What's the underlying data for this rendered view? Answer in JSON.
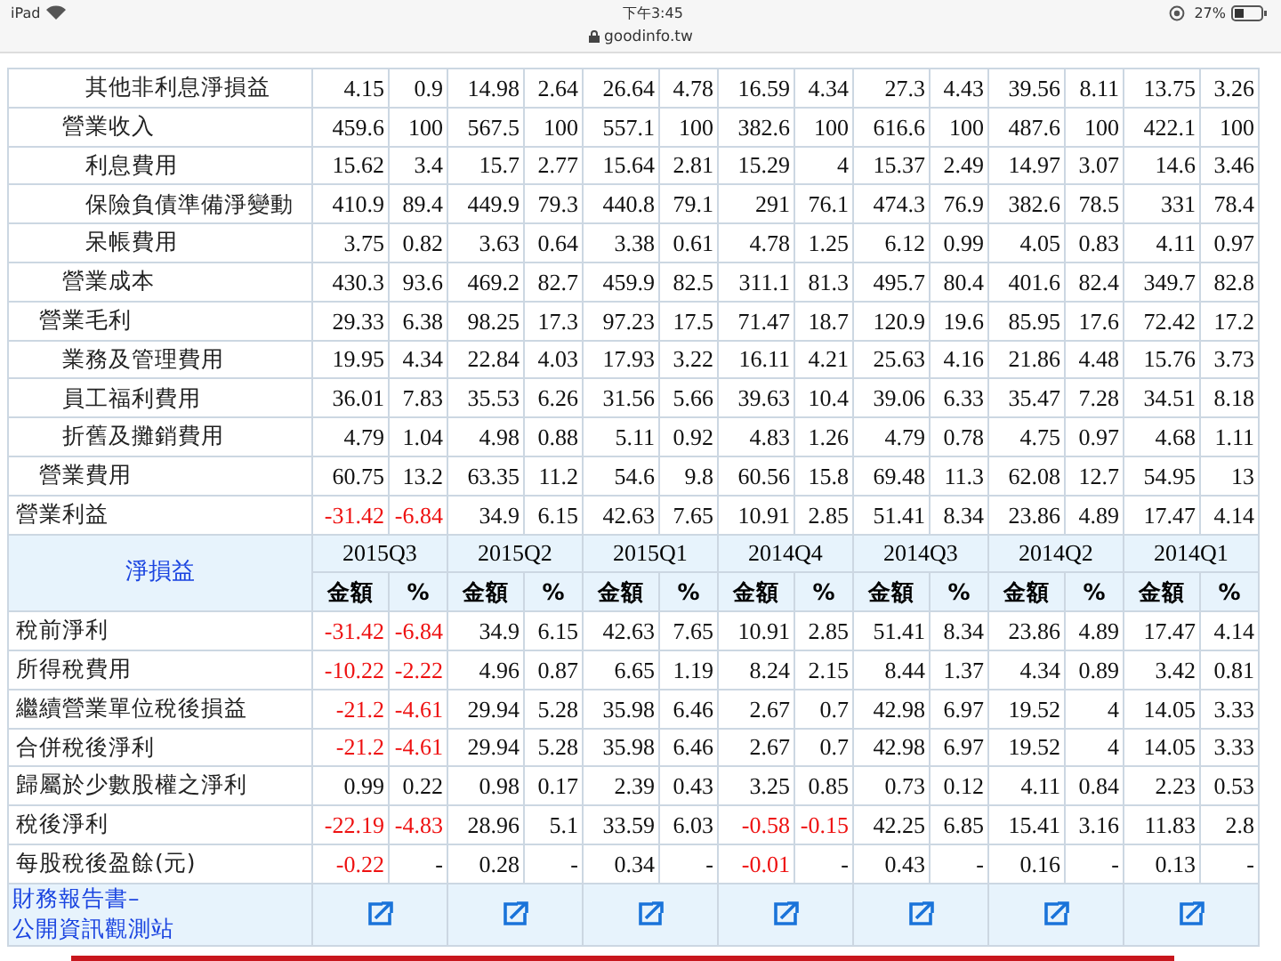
{
  "status_bar": {
    "device": "iPad",
    "time": "下午3:45",
    "battery": "27%"
  },
  "address_bar": {
    "url": "goodinfo.tw"
  },
  "upper_table": {
    "rows": [
      {
        "label": "營業利益",
        "values": [
          "-31.42",
          "-6.84",
          "34.9",
          "6.15",
          "42.63",
          "7.65",
          "10.91",
          "2.85",
          "51.41",
          "8.34",
          "23.86",
          "4.89",
          "17.47",
          "4.14"
        ],
        "red_cells": [
          true,
          true,
          false,
          false,
          false,
          false,
          false,
          false,
          false,
          false,
          false,
          false,
          false,
          false
        ],
        "children": [
          {
            "label": "營業毛利",
            "values": [
              "29.33",
              "6.38",
              "98.25",
              "17.3",
              "97.23",
              "17.5",
              "71.47",
              "18.7",
              "120.9",
              "19.6",
              "85.95",
              "17.6",
              "72.42",
              "17.2"
            ],
            "children": [
              {
                "label": "營業收入",
                "values": [
                  "459.6",
                  "100",
                  "567.5",
                  "100",
                  "557.1",
                  "100",
                  "382.6",
                  "100",
                  "616.6",
                  "100",
                  "487.6",
                  "100",
                  "422.1",
                  "100"
                ],
                "children": [
                  {
                    "label": "其他非利息淨損益",
                    "values": [
                      "4.15",
                      "0.9",
                      "14.98",
                      "2.64",
                      "26.64",
                      "4.78",
                      "16.59",
                      "4.34",
                      "27.3",
                      "4.43",
                      "39.56",
                      "8.11",
                      "13.75",
                      "3.26"
                    ]
                  }
                ]
              },
              {
                "label": "營業成本",
                "values": [
                  "430.3",
                  "93.6",
                  "469.2",
                  "82.7",
                  "459.9",
                  "82.5",
                  "311.1",
                  "81.3",
                  "495.7",
                  "80.4",
                  "401.6",
                  "82.4",
                  "349.7",
                  "82.8"
                ],
                "children": [
                  {
                    "label": "利息費用",
                    "values": [
                      "15.62",
                      "3.4",
                      "15.7",
                      "2.77",
                      "15.64",
                      "2.81",
                      "15.29",
                      "4",
                      "15.37",
                      "2.49",
                      "14.97",
                      "3.07",
                      "14.6",
                      "3.46"
                    ]
                  },
                  {
                    "label": "保險負債準備淨變動",
                    "values": [
                      "410.9",
                      "89.4",
                      "449.9",
                      "79.3",
                      "440.8",
                      "79.1",
                      "291",
                      "76.1",
                      "474.3",
                      "76.9",
                      "382.6",
                      "78.5",
                      "331",
                      "78.4"
                    ]
                  },
                  {
                    "label": "呆帳費用",
                    "values": [
                      "3.75",
                      "0.82",
                      "3.63",
                      "0.64",
                      "3.38",
                      "0.61",
                      "4.78",
                      "1.25",
                      "6.12",
                      "0.99",
                      "4.05",
                      "0.83",
                      "4.11",
                      "0.97"
                    ]
                  }
                ]
              }
            ]
          },
          {
            "label": "營業費用",
            "values": [
              "60.75",
              "13.2",
              "63.35",
              "11.2",
              "54.6",
              "9.8",
              "60.56",
              "15.8",
              "69.48",
              "11.3",
              "62.08",
              "12.7",
              "54.95",
              "13"
            ],
            "children": [
              {
                "label": "業務及管理費用",
                "values": [
                  "19.95",
                  "4.34",
                  "22.84",
                  "4.03",
                  "17.93",
                  "3.22",
                  "16.11",
                  "4.21",
                  "25.63",
                  "4.16",
                  "21.86",
                  "4.48",
                  "15.76",
                  "3.73"
                ]
              },
              {
                "label": "員工福利費用",
                "values": [
                  "36.01",
                  "7.83",
                  "35.53",
                  "6.26",
                  "31.56",
                  "5.66",
                  "39.63",
                  "10.4",
                  "39.06",
                  "6.33",
                  "35.47",
                  "7.28",
                  "34.51",
                  "8.18"
                ]
              },
              {
                "label": "折舊及攤銷費用",
                "values": [
                  "4.79",
                  "1.04",
                  "4.98",
                  "0.88",
                  "5.11",
                  "0.92",
                  "4.83",
                  "1.26",
                  "4.79",
                  "0.78",
                  "4.75",
                  "0.97",
                  "4.68",
                  "1.11"
                ]
              }
            ]
          }
        ]
      }
    ]
  },
  "lower_table": {
    "title": "淨損益",
    "quarters": [
      {
        "name": "2015Q3",
        "amount_header": "金額",
        "percent_header": "%"
      },
      {
        "name": "2015Q2",
        "amount_header": "金額",
        "percent_header": "%"
      },
      {
        "name": "2015Q1",
        "amount_header": "金額",
        "percent_header": "%"
      },
      {
        "name": "2014Q4",
        "amount_header": "金額",
        "percent_header": "%"
      },
      {
        "name": "2014Q3",
        "amount_header": "金額",
        "percent_header": "%"
      },
      {
        "name": "2014Q2",
        "amount_header": "金額",
        "percent_header": "%"
      },
      {
        "name": "2014Q1",
        "amount_header": "金額",
        "percent_header": "%"
      }
    ],
    "rows": [
      {
        "label": "稅前淨利",
        "values": [
          "-31.42",
          "-6.84",
          "34.9",
          "6.15",
          "42.63",
          "7.65",
          "10.91",
          "2.85",
          "51.41",
          "8.34",
          "23.86",
          "4.89",
          "17.47",
          "4.14"
        ],
        "red_cells": [
          true,
          true,
          false,
          false,
          false,
          false,
          false,
          false,
          false,
          false,
          false,
          false,
          false,
          false
        ]
      },
      {
        "label": "所得稅費用",
        "values": [
          "-10.22",
          "-2.22",
          "4.96",
          "0.87",
          "6.65",
          "1.19",
          "8.24",
          "2.15",
          "8.44",
          "1.37",
          "4.34",
          "0.89",
          "3.42",
          "0.81"
        ],
        "red_cells": [
          true,
          true,
          false,
          false,
          false,
          false,
          false,
          false,
          false,
          false,
          false,
          false,
          false,
          false
        ]
      },
      {
        "label": "繼續營業單位稅後損益",
        "values": [
          "-21.2",
          "-4.61",
          "29.94",
          "5.28",
          "35.98",
          "6.46",
          "2.67",
          "0.7",
          "42.98",
          "6.97",
          "19.52",
          "4",
          "14.05",
          "3.33"
        ],
        "red_cells": [
          true,
          true,
          false,
          false,
          false,
          false,
          false,
          false,
          false,
          false,
          false,
          false,
          false,
          false
        ]
      },
      {
        "label": "合併稅後淨利",
        "values": [
          "-21.2",
          "-4.61",
          "29.94",
          "5.28",
          "35.98",
          "6.46",
          "2.67",
          "0.7",
          "42.98",
          "6.97",
          "19.52",
          "4",
          "14.05",
          "3.33"
        ],
        "red_cells": [
          true,
          true,
          false,
          false,
          false,
          false,
          false,
          false,
          false,
          false,
          false,
          false,
          false,
          false
        ]
      },
      {
        "label": "歸屬於少數股權之淨利",
        "values": [
          "0.99",
          "0.22",
          "0.98",
          "0.17",
          "2.39",
          "0.43",
          "3.25",
          "0.85",
          "0.73",
          "0.12",
          "4.11",
          "0.84",
          "2.23",
          "0.53"
        ]
      },
      {
        "label": "稅後淨利",
        "values": [
          "-22.19",
          "-4.83",
          "28.96",
          "5.1",
          "33.59",
          "6.03",
          "-0.58",
          "-0.15",
          "42.25",
          "6.85",
          "15.41",
          "3.16",
          "11.83",
          "2.8"
        ],
        "red_cells": [
          true,
          true,
          false,
          false,
          false,
          false,
          true,
          true,
          false,
          false,
          false,
          false,
          false,
          false
        ]
      },
      {
        "label": "每股稅後盈餘(元)",
        "values": [
          "-0.22",
          "-",
          "0.28",
          "-",
          "0.34",
          "-",
          "-0.01",
          "-",
          "0.43",
          "-",
          "0.16",
          "-",
          "0.13",
          "-"
        ],
        "red_cells": [
          true,
          false,
          false,
          false,
          false,
          false,
          true,
          false,
          false,
          false,
          false,
          false,
          false,
          false
        ]
      }
    ],
    "report_link_lines": [
      "財務報告書–",
      "公開資訊觀測站"
    ]
  }
}
